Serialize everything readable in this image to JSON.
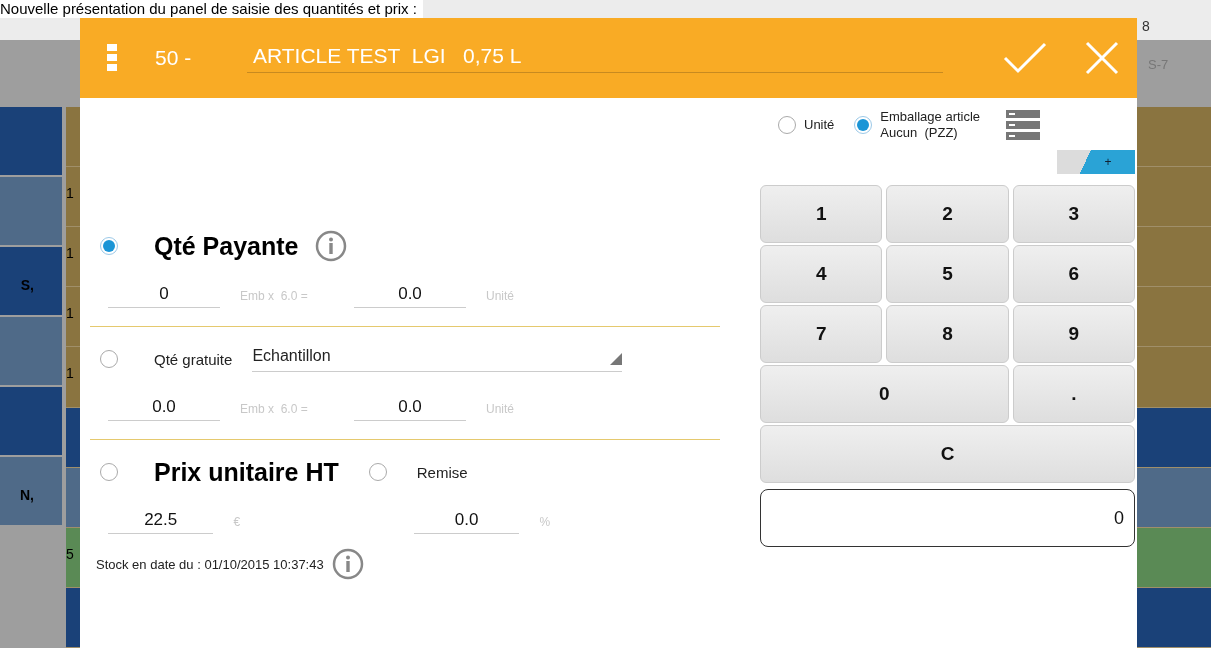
{
  "caption": "Nouvelle présentation du panel de saisie des quantités et prix :",
  "background": {
    "header_number": "8",
    "header_code": "S-7",
    "left_rows": [
      {
        "color": "#1a4178"
      },
      {
        "color": "#4f6a88"
      },
      {
        "color": "#1a4178",
        "text": "S,"
      },
      {
        "color": "#4f6a88"
      },
      {
        "color": "#1a4178"
      },
      {
        "color": "#4f6a88",
        "text": "N,"
      }
    ],
    "strip_rows": [
      {
        "color": "#8a7440"
      },
      {
        "color": "#8a7440",
        "text": "1"
      },
      {
        "color": "#8a7440",
        "text": "1"
      },
      {
        "color": "#8a7440",
        "text": "1"
      },
      {
        "color": "#8a7440",
        "text": "1"
      },
      {
        "color": "#1a4178"
      },
      {
        "color": "#4f6a88"
      },
      {
        "color": "#5a8a55",
        "text": "5"
      },
      {
        "color": "#1a4178"
      }
    ],
    "right_rows": [
      {
        "color": "#8a7440"
      },
      {
        "color": "#8a7440"
      },
      {
        "color": "#8a7440"
      },
      {
        "color": "#8a7440"
      },
      {
        "color": "#8a7440"
      },
      {
        "color": "#1a4178"
      },
      {
        "color": "#4f6a88"
      },
      {
        "color": "#5a8a55"
      },
      {
        "color": "#1a4178"
      }
    ]
  },
  "dialog": {
    "number": "50 -",
    "title": "ARTICLE TEST  LGI   0,75 L",
    "packaging": [
      {
        "label": "Unité",
        "selected": false
      },
      {
        "label": "Emballage article",
        "sub": "Aucun  (PZZ)",
        "selected": true
      }
    ],
    "add_button": "+",
    "sections": [
      {
        "kind": "quantity",
        "label": "Qté Payante",
        "selected": true,
        "fields": [
          {
            "value": "0",
            "unit": "Emb x  6.0 ="
          },
          {
            "value": "0.0",
            "unit": "Unité"
          }
        ]
      },
      {
        "kind": "free",
        "label": "Qté gratuite",
        "selected": false,
        "dropdown": "Echantillon",
        "fields": [
          {
            "value": "0.0",
            "unit": "Emb x  6.0 ="
          },
          {
            "value": "0.0",
            "unit": "Unité"
          }
        ]
      },
      {
        "kind": "price",
        "label": "Prix unitaire HT",
        "selected": false,
        "option": {
          "label": "Remise",
          "selected": false
        },
        "fields": [
          {
            "value": "22.5",
            "unit": "€"
          },
          {
            "value": "0.0",
            "unit": "%"
          }
        ]
      }
    ],
    "stock": "Stock en date du : 01/10/2015 10:37:43",
    "keys": [
      {
        "label": "1",
        "kind": "single"
      },
      {
        "label": "2",
        "kind": "single"
      },
      {
        "label": "3",
        "kind": "single"
      },
      {
        "label": "4",
        "kind": "single"
      },
      {
        "label": "5",
        "kind": "single"
      },
      {
        "label": "6",
        "kind": "single"
      },
      {
        "label": "7",
        "kind": "single"
      },
      {
        "label": "8",
        "kind": "single"
      },
      {
        "label": "9",
        "kind": "single"
      },
      {
        "label": "0",
        "kind": "double"
      },
      {
        "label": ".",
        "kind": "single"
      },
      {
        "label": "C",
        "kind": "triple"
      }
    ],
    "display": "0"
  }
}
